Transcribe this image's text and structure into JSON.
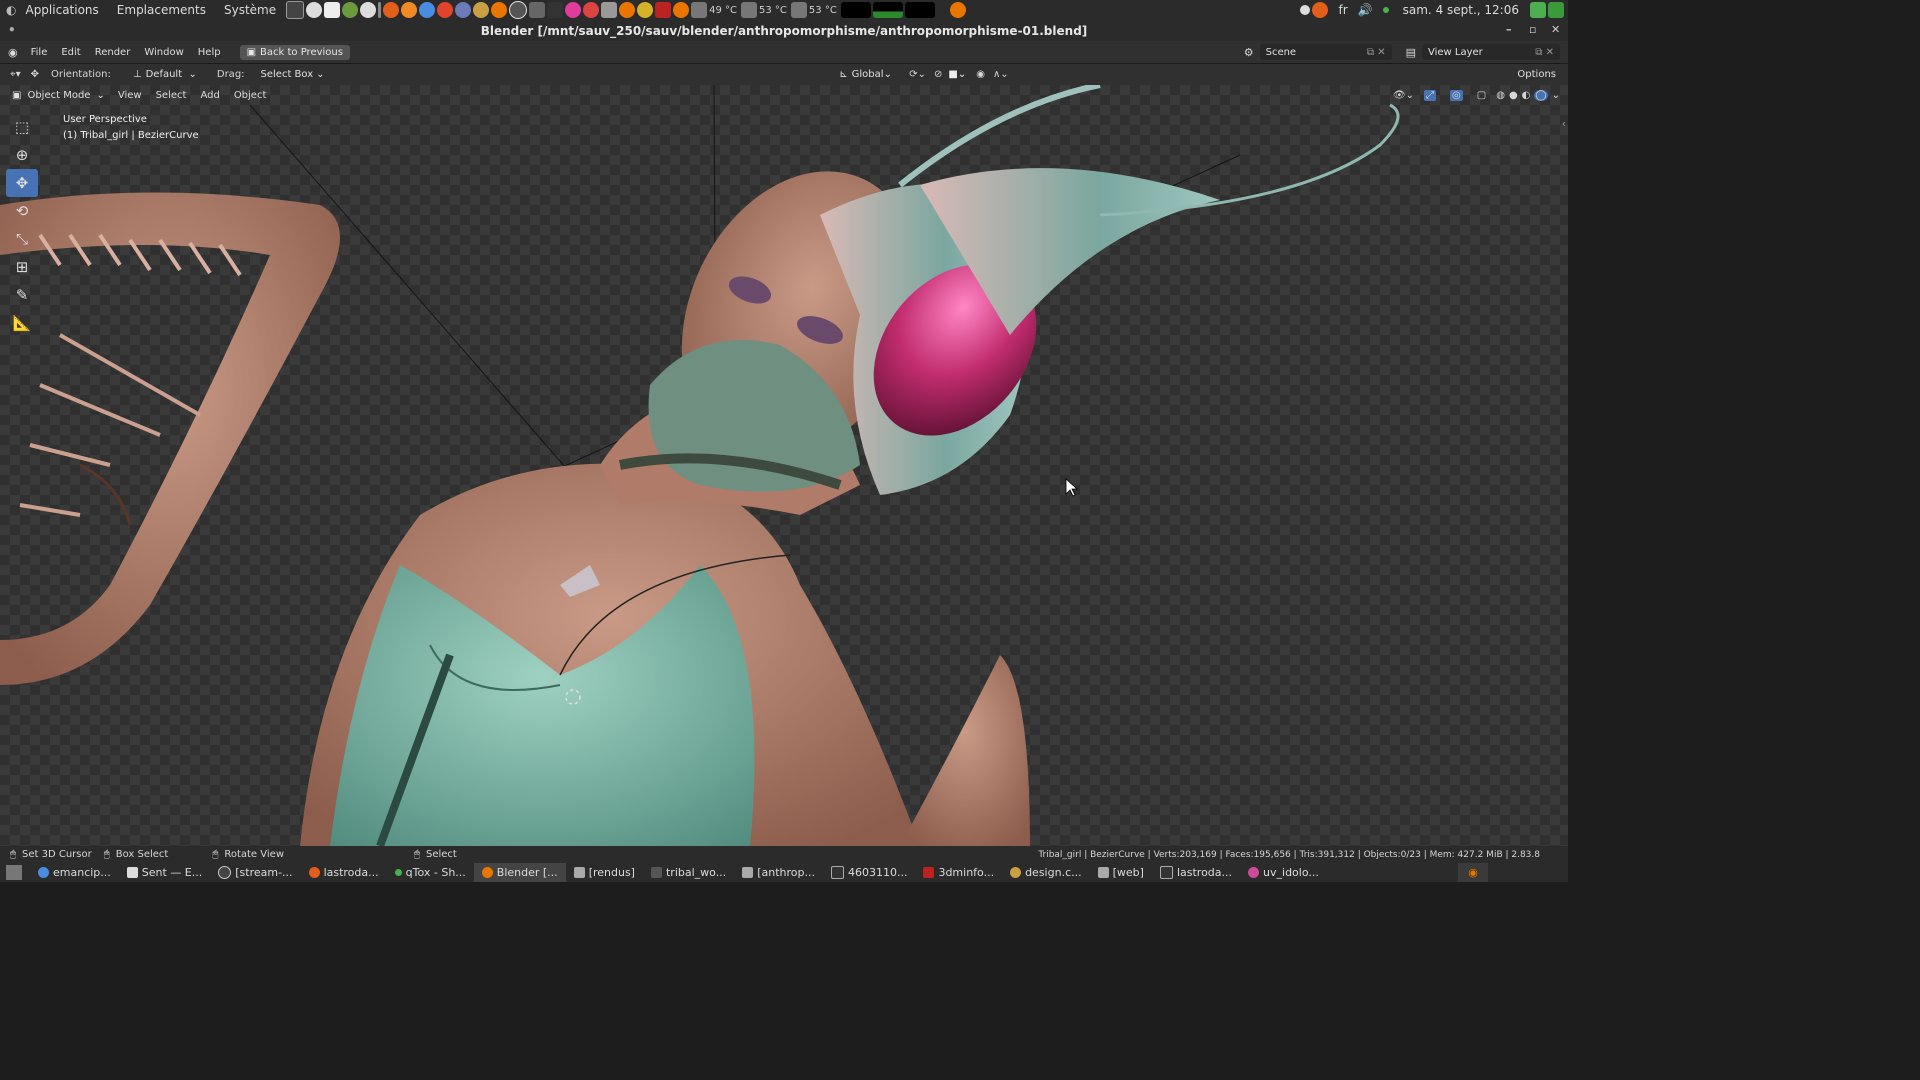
{
  "os_panel": {
    "menus": [
      "Applications",
      "Emplacements",
      "Système"
    ],
    "temps": [
      "49 °C",
      "53 °C",
      "53 °C"
    ],
    "lang": "fr",
    "clock": "sam. 4 sept., 12:06"
  },
  "window": {
    "title": "Blender [/mnt/sauv_250/sauv/blender/anthropomorphisme/anthropomorphisme-01.blend]"
  },
  "menu_bar": {
    "items": [
      "File",
      "Edit",
      "Render",
      "Window",
      "Help"
    ],
    "back_button": "Back to Previous",
    "scene": "Scene",
    "view_layer": "View Layer"
  },
  "tool_header": {
    "orientation_label": "Orientation:",
    "orientation_value": "Default",
    "drag_label": "Drag:",
    "drag_value": "Select Box",
    "transform_orientation": "Global",
    "options": "Options"
  },
  "viewport_header": {
    "mode": "Object Mode",
    "menus": [
      "View",
      "Select",
      "Add",
      "Object"
    ]
  },
  "viewport": {
    "perspective": "User Perspective",
    "active_object": "(1) Tribal_girl | BezierCurve"
  },
  "status_bar": {
    "hints": [
      "Set 3D Cursor",
      "Box Select",
      "Rotate View",
      "Select"
    ],
    "stats": "Tribal_girl | BezierCurve | Verts:203,169 | Faces:195,656 | Tris:391,312 | Objects:0/23 | Mem: 427.2 MiB | 2.83.8"
  },
  "taskbar": {
    "tasks": [
      "emancip...",
      "Sent — E...",
      "[stream-...",
      "lastroda...",
      "qTox - Sh...",
      "Blender [...",
      "[rendus]",
      "tribal_wo...",
      "[anthrop...",
      "4603110...",
      "3dminfo...",
      "design.c...",
      "[web]",
      "lastroda...",
      "uv_idolo..."
    ]
  }
}
